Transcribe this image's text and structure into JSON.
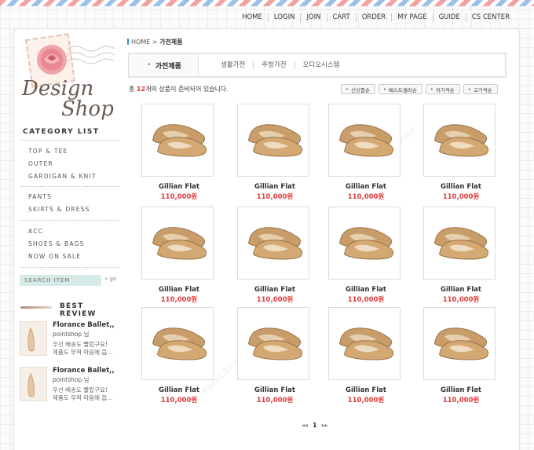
{
  "top_nav": [
    "HOME",
    "LOGIN",
    "JOIN",
    "CART",
    "ORDER",
    "MY PAGE",
    "GUIDE",
    "CS CENTER"
  ],
  "logo": {
    "line1": "Design",
    "line2": "Shop"
  },
  "sidebar": {
    "category_title": "CATEGORY LIST",
    "group1": [
      "TOP & TEE",
      "OUTER",
      "GARDIGAN & KNIT"
    ],
    "group2": [
      "PANTS",
      "SKIRTS & DRESS"
    ],
    "group3": [
      "ACC",
      "SHOES & BAGS",
      "NOW ON SALE"
    ],
    "search_placeholder": "SEARCH ITEM",
    "search_go": "go",
    "review_title": "BEST REVIEW",
    "reviews": [
      {
        "name": "Florance Ballet,,",
        "shop": "pointshop 님",
        "line1": "우선 배송도 빨랐구요!",
        "line2": "제품도 무척 마음에 듭..."
      },
      {
        "name": "Florance Ballet,,",
        "shop": "pointshop 님",
        "line1": "우선 배송도 빨랐구요!",
        "line2": "제품도 무척 마음에 듭..."
      }
    ]
  },
  "breadcrumb": {
    "home": "HOME",
    "sep": ">",
    "current": "가전제품"
  },
  "subnav": {
    "active": "가전제품",
    "items": [
      "생활가전",
      "주방가전",
      "오디오시스템"
    ]
  },
  "count": {
    "prefix": "총",
    "number": "12",
    "suffix": "개의 상품이 준비되어 있습니다."
  },
  "sort": [
    "신상품순",
    "베스트셀러순",
    "저가격순",
    "고가격순"
  ],
  "products": [
    {
      "name": "Gillian Flat",
      "price": "110,000원"
    },
    {
      "name": "Gillian Flat",
      "price": "110,000원"
    },
    {
      "name": "Gillian Flat",
      "price": "110,000원"
    },
    {
      "name": "Gillian Flat",
      "price": "110,000원"
    },
    {
      "name": "Gillian Flat",
      "price": "110,000원"
    },
    {
      "name": "Gillian Flat",
      "price": "110,000원"
    },
    {
      "name": "Gillian Flat",
      "price": "110,000원"
    },
    {
      "name": "Gillian Flat",
      "price": "110,000원"
    },
    {
      "name": "Gillian Flat",
      "price": "110,000원"
    },
    {
      "name": "Gillian Flat",
      "price": "110,000원"
    },
    {
      "name": "Gillian Flat",
      "price": "110,000원"
    },
    {
      "name": "Gillian Flat",
      "price": "110,000원"
    }
  ],
  "pager": {
    "prev": "◂◂",
    "current": "1",
    "next": "▸▸"
  },
  "colors": {
    "price": "#e13b3b",
    "count_number": "#e03333",
    "search_bg": "#d6ebe8",
    "breadcrumb_bar": "#3a8ec9"
  },
  "icons": [
    "rose-stamp-icon",
    "pen-icon",
    "shoe-image-icon",
    "sort-arrow-icon"
  ]
}
